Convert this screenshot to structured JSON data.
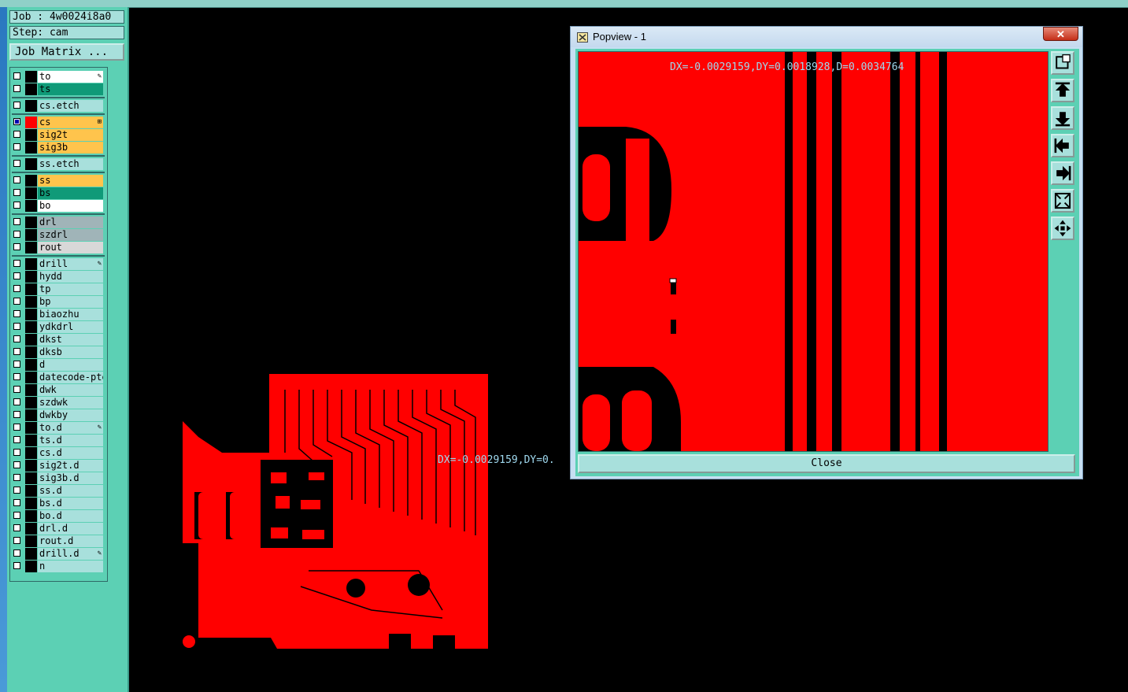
{
  "job_label": "Job : 4w0024i8a0",
  "step_label": "Step: cam",
  "job_matrix_button": "Job Matrix ...",
  "coord_readout_main": "DX=-0.0029159,DY=0.",
  "popview": {
    "title": "Popview - 1",
    "close_x": "✕",
    "coord_readout": "DX=-0.0029159,DY=0.0018928,D=0.0034764",
    "close_button": "Close",
    "toolbar": [
      "zoom-window-icon",
      "move-up-icon",
      "move-down-icon",
      "move-left-icon",
      "move-right-icon",
      "zoom-fit-icon",
      "pan-icon"
    ]
  },
  "colors": {
    "panel": "#5cd0b4",
    "copper": "#ff0000",
    "cell": "#a8e0dc"
  },
  "layers": [
    {
      "name": "to",
      "color": "#ffffff",
      "ind": "✎",
      "checked": false
    },
    {
      "name": "ts",
      "color": "#109a78",
      "checked": false
    },
    {
      "name": "cs.etch",
      "color": "#a8e0dc",
      "checked": false
    },
    {
      "name": "cs",
      "color": "#ffc44c",
      "ind": "⊞",
      "checked": true,
      "active": true
    },
    {
      "name": "sig2t",
      "color": "#ffc44c",
      "checked": false
    },
    {
      "name": "sig3b",
      "color": "#ffc44c",
      "checked": false
    },
    {
      "name": "ss.etch",
      "color": "#a8e0dc",
      "checked": false
    },
    {
      "name": "ss",
      "color": "#ffc44c",
      "checked": false
    },
    {
      "name": "bs",
      "color": "#109a78",
      "checked": false
    },
    {
      "name": "bo",
      "color": "#ffffff",
      "checked": false
    },
    {
      "name": "drl",
      "color": "#a0b4b8",
      "checked": false
    },
    {
      "name": "szdrl",
      "color": "#a0b4b8",
      "checked": false
    },
    {
      "name": "rout",
      "color": "#d8d8d8",
      "checked": false
    },
    {
      "name": "drill",
      "color": "#a8e0dc",
      "ind": "✎",
      "checked": false
    },
    {
      "name": "hydd",
      "color": "#a8e0dc",
      "checked": false
    },
    {
      "name": "tp",
      "color": "#a8e0dc",
      "checked": false
    },
    {
      "name": "bp",
      "color": "#a8e0dc",
      "checked": false
    },
    {
      "name": "biaozhu",
      "color": "#a8e0dc",
      "checked": false
    },
    {
      "name": "ydkdrl",
      "color": "#a8e0dc",
      "checked": false
    },
    {
      "name": "dkst",
      "color": "#a8e0dc",
      "checked": false
    },
    {
      "name": "dksb",
      "color": "#a8e0dc",
      "checked": false
    },
    {
      "name": "d",
      "color": "#a8e0dc",
      "checked": false
    },
    {
      "name": "datecode-pte",
      "color": "#a8e0dc",
      "checked": false
    },
    {
      "name": "dwk",
      "color": "#a8e0dc",
      "checked": false
    },
    {
      "name": "szdwk",
      "color": "#a8e0dc",
      "checked": false
    },
    {
      "name": "dwkby",
      "color": "#a8e0dc",
      "checked": false
    },
    {
      "name": "to.d",
      "color": "#a8e0dc",
      "ind": "✎",
      "checked": false
    },
    {
      "name": "ts.d",
      "color": "#a8e0dc",
      "checked": false
    },
    {
      "name": "cs.d",
      "color": "#a8e0dc",
      "checked": false
    },
    {
      "name": "sig2t.d",
      "color": "#a8e0dc",
      "checked": false
    },
    {
      "name": "sig3b.d",
      "color": "#a8e0dc",
      "checked": false
    },
    {
      "name": "ss.d",
      "color": "#a8e0dc",
      "checked": false
    },
    {
      "name": "bs.d",
      "color": "#a8e0dc",
      "checked": false
    },
    {
      "name": "bo.d",
      "color": "#a8e0dc",
      "checked": false
    },
    {
      "name": "drl.d",
      "color": "#a8e0dc",
      "checked": false
    },
    {
      "name": "rout.d",
      "color": "#a8e0dc",
      "checked": false
    },
    {
      "name": "drill.d",
      "color": "#a8e0dc",
      "ind": "✎",
      "checked": false
    },
    {
      "name": "n",
      "color": "#a8e0dc",
      "checked": false
    }
  ]
}
